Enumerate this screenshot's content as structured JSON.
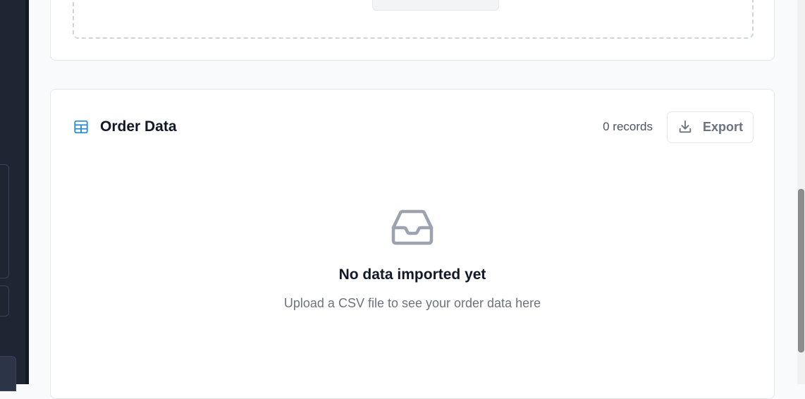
{
  "order_data": {
    "title": "Order Data",
    "icon": "table-icon",
    "records_label": "0 records",
    "export_label": "Export",
    "export_icon": "download-icon"
  },
  "empty_state": {
    "icon": "inbox-icon",
    "title": "No data imported yet",
    "subtitle": "Upload a CSV file to see your order data here"
  },
  "colors": {
    "accent": "#2b8ad6",
    "sidebar_bg": "#1e2533",
    "muted_icon": "#9ca3af"
  }
}
